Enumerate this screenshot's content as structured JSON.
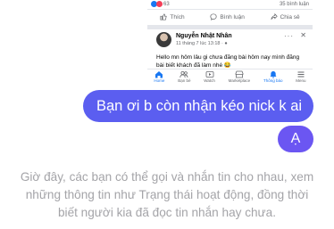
{
  "post": {
    "reaction_count": "63",
    "comment_count": "35 bình luận",
    "actions": {
      "like": "Thích",
      "comment": "Bình luận",
      "share": "Chia sẻ"
    },
    "author": "Nguyễn Nhật Nhân",
    "time": "11 tháng 7 lúc 13:18 · ",
    "text": "Hello mn hôm lâu gi chưa đăng bài hôm nay mình đăng bài biết khách đã làm nhé 😂",
    "tabs": [
      "Home",
      "Bạn bè",
      "Watch",
      "Marketplace",
      "Thông báo",
      "Menu"
    ]
  },
  "chat": {
    "message_main": "Bạn ơi b còn nhận kéo nick k ai",
    "message_small": "Ạ"
  },
  "info": {
    "line1": "Giờ đây, các bạn có thể gọi và nhắn tin cho nhau, xem",
    "line2": "những thông tin như Trạng thái hoạt động, đồng thời",
    "line3": "biết người kia đã đọc tin nhắn hay chưa."
  },
  "colors": {
    "bubble": "#5b5ef0",
    "fb_blue": "#1877f2",
    "info_text": "#a4a4a8"
  },
  "icons": [
    "like-icon",
    "comment-icon",
    "share-icon",
    "close-icon",
    "more-icon",
    "home-icon",
    "friends-icon",
    "watch-icon",
    "marketplace-icon",
    "bell-icon",
    "menu-icon"
  ]
}
